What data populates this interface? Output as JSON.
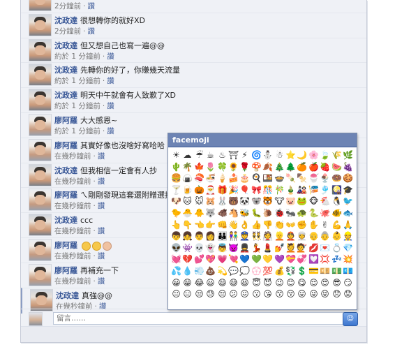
{
  "comments": [
    {
      "name": "",
      "text": "",
      "time": "2分鐘前",
      "sep": "·",
      "like": "讚",
      "avatar": "a"
    },
    {
      "name": "沈政達",
      "text": "很想轉你的就好XD",
      "time": "2分鐘前",
      "sep": "·",
      "like": "讚",
      "avatar": "a"
    },
    {
      "name": "沈政達",
      "text": "但又想自己也寫一遍@@",
      "time": "約於 1 分鐘前",
      "sep": "·",
      "like": "讚",
      "avatar": "a"
    },
    {
      "name": "沈政達",
      "text": "先轉你的好了，你賺幾天流量",
      "time": "約於 1 分鐘前",
      "sep": "·",
      "like": "讚",
      "avatar": "a"
    },
    {
      "name": "沈政達",
      "text": "明天中午就會有人致歉了XD",
      "time": "約於 1 分鐘前",
      "sep": "·",
      "like": "讚",
      "avatar": "a"
    },
    {
      "name": "廖阿羅",
      "text": "大大感恩~",
      "time": "約於 1 分鐘前",
      "sep": "·",
      "like": "讚",
      "avatar": "b"
    },
    {
      "name": "廖阿羅",
      "text": "其實好像也沒啥好寫哈哈",
      "time": "在幾秒鐘前",
      "sep": "·",
      "like": "讚",
      "avatar": "b"
    },
    {
      "name": "沈政達",
      "text": "但我相信一定會有人抄",
      "time": "在幾秒鐘前",
      "sep": "·",
      "like": "讚",
      "avatar": "a"
    },
    {
      "name": "廖阿羅",
      "text": "ㄟ剛剛發現這套還附贈選擇",
      "time": "在幾秒鐘前",
      "sep": "·",
      "like": "讚",
      "avatar": "b"
    },
    {
      "name": "沈政達",
      "text": "ccc",
      "time": "在幾秒鐘前",
      "sep": "·",
      "like": "讚",
      "avatar": "a"
    },
    {
      "name": "廖阿羅",
      "text": "",
      "emoji": true,
      "time": "在幾秒鐘前",
      "sep": "·",
      "like": "讚",
      "avatar": "b"
    },
    {
      "name": "廖阿羅",
      "text": "再補充一下",
      "time": "在幾秒鐘前",
      "sep": "·",
      "like": "讚",
      "avatar": "b"
    },
    {
      "name": "沈政達",
      "text": "真強@@",
      "time": "在幾秒鐘前",
      "sep": "·",
      "like": "讚",
      "avatar": "a",
      "active": true
    }
  ],
  "reply": {
    "placeholder": "留言……"
  },
  "facemoji": {
    "title": "facemoji",
    "rows": [
      [
        "☀",
        "☁",
        "☔",
        "☕",
        "♨",
        "⛩",
        "⚡",
        "🌀",
        "⛄",
        "☃",
        "⭐",
        "🌙",
        "🌸",
        "🍃",
        "🌾",
        "🌿"
      ],
      [
        "🌵",
        "🌴",
        "🍁",
        "🌷",
        "🍀",
        "🌻",
        "🌹",
        "🍄",
        "🍂",
        "🎄",
        "🌲",
        "🍊",
        "🍎",
        "🍓",
        "🍉",
        "🍇"
      ],
      [
        "🍔",
        "🍙",
        "🍣",
        "🍜",
        "🍦",
        "🍰",
        "🎂",
        "🍳",
        "🍱",
        "🍲",
        "🍡",
        "🍢",
        "🍧",
        "🍨",
        "🍩",
        "🍪"
      ],
      [
        "🍸",
        "🍺",
        "🎃",
        "🎅",
        "🎁",
        "🎉",
        "🎈",
        "🎀",
        "🎊",
        "🎋",
        "🎍",
        "🎎",
        "🎏",
        "🎐",
        "🎑",
        "🎓"
      ],
      [
        "🐶",
        "🐱",
        "🐭",
        "🐹",
        "🐰",
        "🐻",
        "🐼",
        "🐨",
        "🐯",
        "🐮",
        "🐷",
        "🐸",
        "🐵",
        "🐔",
        "🐧",
        "🐦"
      ],
      [
        "🐤",
        "🐣",
        "🐥",
        "🐺",
        "🐗",
        "🐴",
        "🐝",
        "🐛",
        "🐌",
        "🐞",
        "🐜",
        "🐢",
        "🐍",
        "🐙",
        "🐠",
        "🐟"
      ],
      [
        "👆",
        "👇",
        "👈",
        "👉",
        "👊",
        "👋",
        "👌",
        "👍",
        "👎",
        "👏",
        "👐",
        "✊",
        "✋",
        "✌",
        "💪",
        "🙏"
      ],
      [
        "👦",
        "👧",
        "👨",
        "👩",
        "👪",
        "👫",
        "👮",
        "👯",
        "👰",
        "👱",
        "👲",
        "👳",
        "👴",
        "👵",
        "👶",
        "👷"
      ],
      [
        "👽",
        "👾",
        "💀",
        "👻",
        "👼",
        "👿",
        "💂",
        "💃",
        "💄",
        "💅",
        "💆",
        "💇",
        "💋",
        "💌",
        "💍",
        "💎"
      ],
      [
        "💓",
        "💔",
        "💕",
        "💖",
        "💗",
        "💘",
        "💙",
        "💚",
        "💛",
        "💜",
        "💝",
        "💞",
        "💟",
        "💢",
        "💤",
        "💥"
      ],
      [
        "💦",
        "💧",
        "💨",
        "💩",
        "💫",
        "💬",
        "💭",
        "💮",
        "💯",
        "💰",
        "💱",
        "💲",
        "💳",
        "💴",
        "💵",
        "💶"
      ],
      [
        "😀",
        "😁",
        "😂",
        "😃",
        "😄",
        "😅",
        "😆",
        "😇",
        "😈",
        "😉",
        "😊",
        "😋",
        "😌",
        "😍",
        "😎",
        "😏"
      ],
      [
        "😐",
        "😑",
        "😒",
        "😓",
        "😔",
        "😕",
        "😖",
        "😗",
        "😘",
        "😙",
        "😚",
        "😛",
        "😜",
        "😝",
        "😞",
        "😟"
      ]
    ]
  }
}
